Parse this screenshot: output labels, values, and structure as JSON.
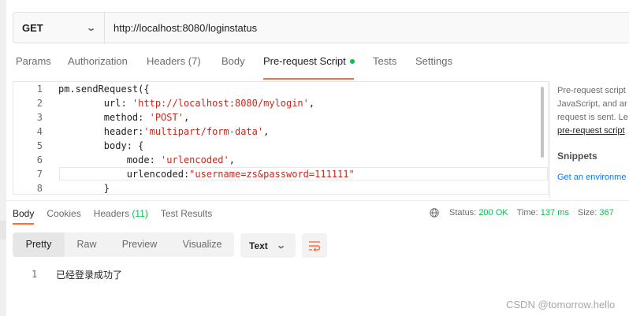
{
  "request": {
    "method": "GET",
    "url": "http://localhost:8080/loginstatus"
  },
  "request_tabs": [
    {
      "label": "Params"
    },
    {
      "label": "Authorization"
    },
    {
      "label": "Headers",
      "count": "(7)"
    },
    {
      "label": "Body"
    },
    {
      "label": "Pre-request Script",
      "active": true
    },
    {
      "label": "Tests"
    },
    {
      "label": "Settings"
    }
  ],
  "editor": {
    "line_numbers": [
      "1",
      "2",
      "3",
      "4",
      "5",
      "6",
      "7",
      "8"
    ],
    "lines": [
      "pm.sendRequest({",
      "        url: 'http://localhost:8080/mylogin',",
      "        method: 'POST',",
      "        header:'multipart/form-data',",
      "        body: {",
      "            mode: 'urlencoded',",
      "            urlencoded:\"username=zs&password=111111\"",
      "        }"
    ]
  },
  "side_panel": {
    "desc_lines": [
      "Pre-request script",
      "JavaScript, and ar",
      "request is sent. Le",
      "pre-request script"
    ],
    "snippets_title": "Snippets",
    "snippet_item": "Get an environme"
  },
  "response": {
    "tabs": [
      {
        "label": "Body",
        "active": true
      },
      {
        "label": "Cookies"
      },
      {
        "label": "Headers",
        "count": "(11)"
      },
      {
        "label": "Test Results"
      }
    ],
    "status_label": "Status:",
    "status_value": "200 OK",
    "time_label": "Time:",
    "time_value": "137 ms",
    "size_label": "Size:",
    "size_value": "367",
    "view_modes": [
      "Pretty",
      "Raw",
      "Preview",
      "Visualize"
    ],
    "format": "Text",
    "body_line": "1",
    "body_text": "已经登录成功了"
  },
  "watermark": "CSDN @tomorrow.hello",
  "colors": {
    "accent": "#ff6c37",
    "status_ok": "#0cbb52",
    "string": "#c5281c"
  },
  "icons": [
    "chevron-down-icon",
    "globe-icon",
    "wrap-lines-icon"
  ]
}
